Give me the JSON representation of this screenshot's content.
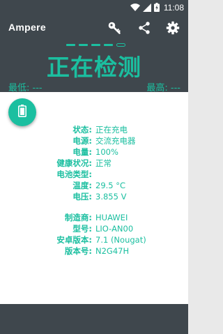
{
  "status_bar": {
    "time": "11:08",
    "icons": [
      "wifi-icon",
      "signal-icon",
      "battery-charging-icon"
    ]
  },
  "header": {
    "title": "Ampere",
    "actions": [
      "key-icon",
      "share-icon",
      "settings-icon"
    ],
    "status_text": "正在检测",
    "min_label": "最低: ---",
    "max_label": "最高: ---"
  },
  "fab": {
    "icon": "battery-icon"
  },
  "info": {
    "status": {
      "label": "状态:",
      "value": "正在充电"
    },
    "power_source": {
      "label": "电源:",
      "value": "交流充电器"
    },
    "level": {
      "label": "电量:",
      "value": "100%"
    },
    "health": {
      "label": "健康状况:",
      "value": "正常"
    },
    "battery_type": {
      "label": "电池类型:",
      "value": ""
    },
    "temperature": {
      "label": "温度:",
      "value": "29.5 °C"
    },
    "voltage": {
      "label": "电压:",
      "value": "3.855 V"
    }
  },
  "device": {
    "manufacturer": {
      "label": "制造商:",
      "value": "HUAWEI"
    },
    "model": {
      "label": "型号:",
      "value": "LIO-AN00"
    },
    "android_version": {
      "label": "安卓版本:",
      "value": "7.1 (Nougat)"
    },
    "build_number": {
      "label": "版本号:",
      "value": "N2G47H"
    }
  },
  "colors": {
    "accent": "#1bbfa0",
    "toolbar": "#3f474d",
    "background": "#e9e9e9",
    "card": "#ffffff"
  }
}
